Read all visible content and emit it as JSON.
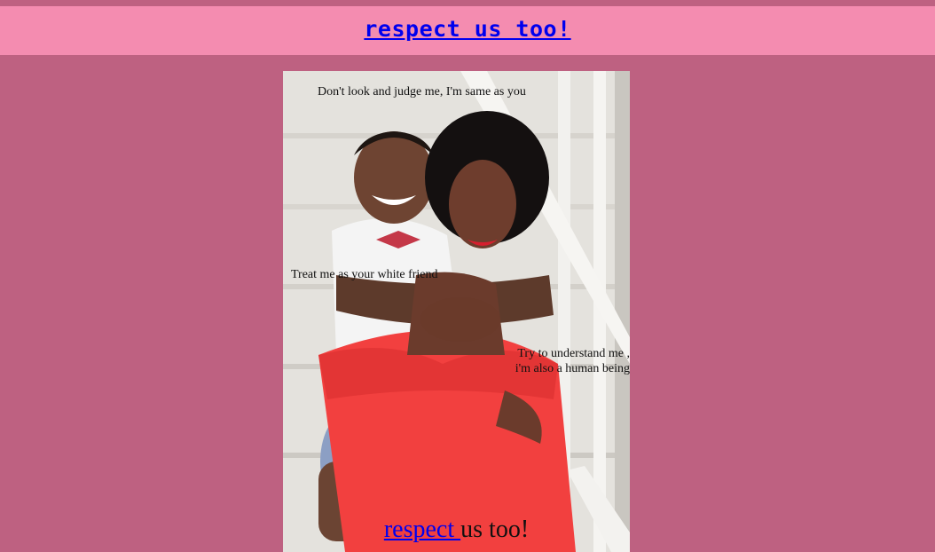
{
  "header": {
    "title_link": "respect us too!"
  },
  "photo": {
    "subject": "photo of a smiling woman in a red dress with a boy hugging her from behind, seated on steps"
  },
  "captions": {
    "top": "Don't look and judge me, I'm same as you",
    "middle": "Treat me as your white friend",
    "right_line1": "Try to understand me ,",
    "right_line2": "i'm also a human being"
  },
  "footer_title": {
    "link_text": "respect ",
    "rest_text": "us too!"
  },
  "colors": {
    "page_bg": "#be6181",
    "header_bg": "#f48cb0",
    "link": "#0000ee",
    "dress_red": "#f2403f"
  }
}
